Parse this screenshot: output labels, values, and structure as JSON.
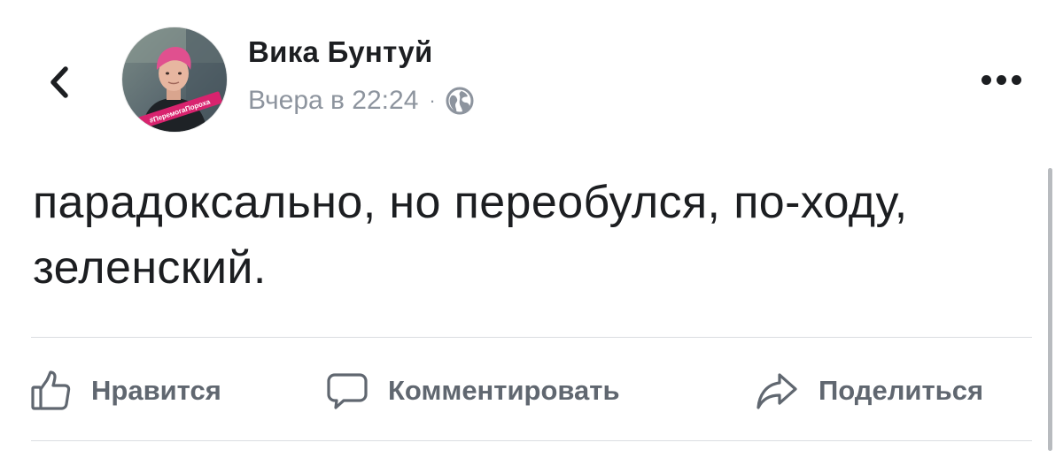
{
  "post": {
    "author_name": "Вика Бунтуй",
    "timestamp": "Вчера в 22:24",
    "separator": "·",
    "privacy_icon": "globe-icon",
    "avatar_badge_text": "#ПеремогаПороха",
    "text": "парадоксально, но переобулся, по-ходу, зеленский."
  },
  "actions": {
    "like_label": "Нравится",
    "comment_label": "Комментировать",
    "share_label": "Поделиться"
  },
  "icons": {
    "back": "chevron-left-icon",
    "more": "more-dots-icon",
    "like": "thumbs-up-icon",
    "comment": "comment-bubble-icon",
    "share": "share-arrow-icon"
  },
  "colors": {
    "text_primary": "#1c1e21",
    "text_secondary": "#8d949e",
    "action_text": "#606770",
    "divider": "#dadde1",
    "avatar_badge": "#d8236e"
  }
}
